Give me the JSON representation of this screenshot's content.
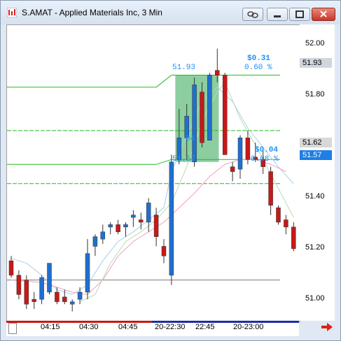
{
  "window": {
    "title": "S.AMAT - Applied Materials Inc, 3 Min"
  },
  "colors": {
    "up": "#1f6fd0",
    "down": "#c81818",
    "green": "#22bb22",
    "zone": "#3fae5f",
    "accent": "#1e90ff"
  },
  "y_axis": {
    "ticks": [
      "52.00",
      "51.80",
      "51.60",
      "51.40",
      "51.20",
      "51.00"
    ]
  },
  "price_tags": [
    {
      "label": "51.93",
      "bg": "#cfd6de",
      "fg": "#000000"
    },
    {
      "label": "51.62",
      "bg": "#d8d8d8",
      "fg": "#000000"
    },
    {
      "label": "51.57",
      "bg": "#1e7fe6",
      "fg": "#ffffff"
    }
  ],
  "x_axis": {
    "labels": [
      "04:15",
      "04:30",
      "04:45",
      "20-22:30",
      "22:45",
      "20-23:00"
    ]
  },
  "annotations": {
    "upper_change": "$0.31",
    "upper_pct": "0.60 %",
    "lower_change": "$0.04",
    "lower_pct": "0.08 %",
    "zone_top": "51.93",
    "zone_bottom": "51.57",
    "zone_mid": "84"
  },
  "chart_data": {
    "type": "candlestick",
    "ylim": [
      50.92,
      52.12
    ],
    "candles": [
      {
        "o": 51.16,
        "h": 51.18,
        "l": 51.09,
        "c": 51.1,
        "dir": "down"
      },
      {
        "o": 51.1,
        "h": 51.12,
        "l": 51.0,
        "c": 51.02,
        "dir": "down"
      },
      {
        "o": 51.08,
        "h": 51.1,
        "l": 50.96,
        "c": 50.98,
        "dir": "down"
      },
      {
        "o": 51.0,
        "h": 51.03,
        "l": 50.96,
        "c": 50.99,
        "dir": "down"
      },
      {
        "o": 51.0,
        "h": 51.1,
        "l": 50.98,
        "c": 51.09,
        "dir": "up"
      },
      {
        "o": 51.03,
        "h": 51.14,
        "l": 51.02,
        "c": 51.15,
        "dir": "up"
      },
      {
        "o": 51.03,
        "h": 51.05,
        "l": 50.98,
        "c": 50.99,
        "dir": "down"
      },
      {
        "o": 51.01,
        "h": 51.04,
        "l": 50.98,
        "c": 50.99,
        "dir": "down"
      },
      {
        "o": 50.98,
        "h": 51.0,
        "l": 50.95,
        "c": 50.99,
        "dir": "up"
      },
      {
        "o": 51.0,
        "h": 51.05,
        "l": 50.98,
        "c": 51.03,
        "dir": "up"
      },
      {
        "o": 51.03,
        "h": 51.25,
        "l": 51.0,
        "c": 51.19,
        "dir": "up"
      },
      {
        "o": 51.22,
        "h": 51.27,
        "l": 51.18,
        "c": 51.26,
        "dir": "up"
      },
      {
        "o": 51.25,
        "h": 51.31,
        "l": 51.23,
        "c": 51.28,
        "dir": "up"
      },
      {
        "o": 51.3,
        "h": 51.32,
        "l": 51.27,
        "c": 51.31,
        "dir": "up"
      },
      {
        "o": 51.31,
        "h": 51.33,
        "l": 51.27,
        "c": 51.28,
        "dir": "down"
      },
      {
        "o": 51.3,
        "h": 51.32,
        "l": 51.26,
        "c": 51.31,
        "dir": "up"
      },
      {
        "o": 51.34,
        "h": 51.37,
        "l": 51.3,
        "c": 51.35,
        "dir": "up"
      },
      {
        "o": 51.33,
        "h": 51.36,
        "l": 51.29,
        "c": 51.32,
        "dir": "down"
      },
      {
        "o": 51.32,
        "h": 51.42,
        "l": 51.28,
        "c": 51.4,
        "dir": "up"
      },
      {
        "o": 51.35,
        "h": 51.38,
        "l": 51.22,
        "c": 51.26,
        "dir": "down"
      },
      {
        "o": 51.22,
        "h": 51.25,
        "l": 51.15,
        "c": 51.18,
        "dir": "down"
      },
      {
        "o": 51.1,
        "h": 51.6,
        "l": 51.06,
        "c": 51.57,
        "dir": "up"
      },
      {
        "o": 51.58,
        "h": 51.79,
        "l": 51.56,
        "c": 51.67,
        "dir": "up"
      },
      {
        "o": 51.67,
        "h": 51.81,
        "l": 51.58,
        "c": 51.76,
        "dir": "up"
      },
      {
        "o": 51.57,
        "h": 51.92,
        "l": 51.55,
        "c": 51.89,
        "dir": "up"
      },
      {
        "o": 51.65,
        "h": 51.9,
        "l": 51.63,
        "c": 51.86,
        "dir": "down"
      },
      {
        "o": 51.66,
        "h": 51.94,
        "l": 51.66,
        "c": 51.93,
        "dir": "up"
      },
      {
        "o": 51.95,
        "h": 52.04,
        "l": 51.9,
        "c": 51.93,
        "dir": "down"
      },
      {
        "o": 51.93,
        "h": 51.94,
        "l": 51.6,
        "c": 51.6,
        "dir": "down"
      },
      {
        "o": 51.55,
        "h": 51.57,
        "l": 51.49,
        "c": 51.53,
        "dir": "down"
      },
      {
        "o": 51.54,
        "h": 51.68,
        "l": 51.5,
        "c": 51.67,
        "dir": "up"
      },
      {
        "o": 51.67,
        "h": 51.7,
        "l": 51.56,
        "c": 51.58,
        "dir": "down"
      },
      {
        "o": 51.59,
        "h": 51.65,
        "l": 51.57,
        "c": 51.58,
        "dir": "down"
      },
      {
        "o": 51.58,
        "h": 51.62,
        "l": 51.52,
        "c": 51.55,
        "dir": "down"
      },
      {
        "o": 51.53,
        "h": 51.55,
        "l": 51.35,
        "c": 51.39,
        "dir": "down"
      },
      {
        "o": 51.38,
        "h": 51.39,
        "l": 51.31,
        "c": 51.32,
        "dir": "down"
      },
      {
        "o": 51.33,
        "h": 51.35,
        "l": 51.27,
        "c": 51.3,
        "dir": "down"
      },
      {
        "o": 51.3,
        "h": 51.32,
        "l": 51.2,
        "c": 51.21,
        "dir": "down"
      }
    ],
    "levels": [
      {
        "value": 51.93,
        "style": "solid-green"
      },
      {
        "value": 51.7,
        "style": "dashed-green"
      },
      {
        "value": 51.58,
        "style": "solid-green"
      },
      {
        "value": 51.48,
        "style": "dashed-green"
      },
      {
        "value": 51.08,
        "style": "gray"
      }
    ]
  }
}
